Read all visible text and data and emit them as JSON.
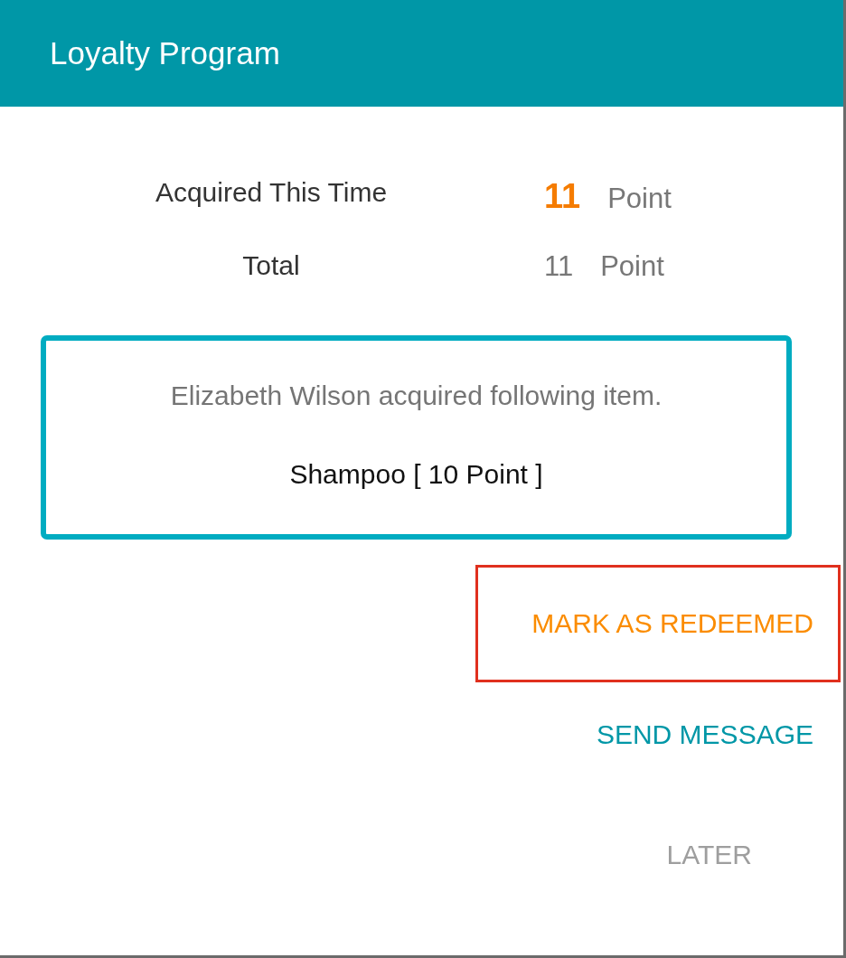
{
  "dialog": {
    "title": "Loyalty Program",
    "stats": [
      {
        "label": "Acquired This Time",
        "value": "11",
        "unit": "Point",
        "highlighted": true
      },
      {
        "label": "Total",
        "value": "11",
        "unit": "Point",
        "highlighted": false
      }
    ],
    "notice": {
      "message": "Elizabeth Wilson acquired following item.",
      "item": "Shampoo [ 10 Point ]"
    },
    "actions": [
      {
        "label": "MARK AS REDEEMED",
        "kind": "accent",
        "outlined": true
      },
      {
        "label": "SEND MESSAGE",
        "kind": "primary",
        "outlined": false
      },
      {
        "label": "LATER",
        "kind": "muted",
        "outlined": false
      }
    ]
  }
}
